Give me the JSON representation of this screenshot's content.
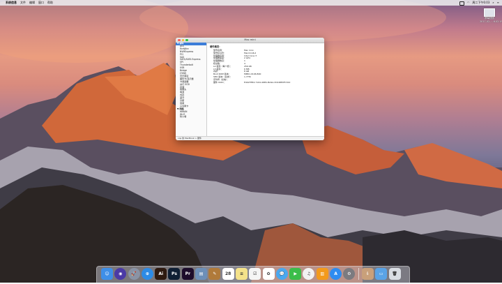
{
  "menubar": {
    "apple": "",
    "items": [
      "系统信息",
      "文件",
      "编辑",
      "窗口",
      "帮助"
    ],
    "clock": "周二下午6:03"
  },
  "desktop": {
    "file_label_1": "屏幕快照",
    "file_label_2": "2017-02-... 6.02.19"
  },
  "window": {
    "title": "Mac mini",
    "sidebar": [
      {
        "label": "▼ 硬件",
        "type": "hdr",
        "selected": true
      },
      {
        "label": "ATA",
        "type": "item"
      },
      {
        "label": "FireWire",
        "type": "item"
      },
      {
        "label": "NVMExpress",
        "type": "item"
      },
      {
        "label": "PCI",
        "type": "item"
      },
      {
        "label": "SAS",
        "type": "item"
      },
      {
        "label": "SATA/SATA Express",
        "type": "item"
      },
      {
        "label": "SPI",
        "type": "item"
      },
      {
        "label": "Thunderbolt",
        "type": "item"
      },
      {
        "label": "USB",
        "type": "item"
      },
      {
        "label": "Bridge",
        "type": "item"
      },
      {
        "label": "打印机",
        "type": "item"
      },
      {
        "label": "光纤通道",
        "type": "item"
      },
      {
        "label": "图形卡/显示器",
        "type": "item"
      },
      {
        "label": "卡阅读器",
        "type": "item"
      },
      {
        "label": "并行 SCSI",
        "type": "item"
      },
      {
        "label": "存储",
        "type": "item"
      },
      {
        "label": "摄像头",
        "type": "item"
      },
      {
        "label": "电源",
        "type": "item"
      },
      {
        "label": "内存",
        "type": "item"
      },
      {
        "label": "蓝牙",
        "type": "item"
      },
      {
        "label": "诊断",
        "type": "item"
      },
      {
        "label": "音频",
        "type": "item"
      },
      {
        "label": "以太网卡",
        "type": "item"
      },
      {
        "label": "▼ 网络",
        "type": "hdr"
      },
      {
        "label": "WWAN",
        "type": "item"
      },
      {
        "label": "Wi-Fi",
        "type": "item"
      },
      {
        "label": "防火墙",
        "type": "item"
      }
    ],
    "detail": {
      "heading": "硬件概览：",
      "rows": [
        {
          "k": "型号名称：",
          "v": "Mac mini"
        },
        {
          "k": "型号标识符：",
          "v": "Macmini6,2"
        },
        {
          "k": "处理器名称：",
          "v": "Intel Core i7"
        },
        {
          "k": "处理器速度：",
          "v": "2 GHz"
        },
        {
          "k": "处理器数目：",
          "v": "1"
        },
        {
          "k": "核总数：",
          "v": "4"
        },
        {
          "k": "L2 缓存（每个核）：",
          "v": "256 KB"
        },
        {
          "k": "L3 缓存：",
          "v": "6 MB"
        },
        {
          "k": "内存：",
          "v": "8 GB"
        },
        {
          "k": "Boot ROM 版本：",
          "v": "MM61.0106.B00"
        },
        {
          "k": "SMC 版本（系统）：",
          "v": "1.77f0"
        },
        {
          "k": "序列号（系统）：",
          "v": ""
        },
        {
          "k": "硬件 UUID：",
          "v": "E4927E84-7104-4DB1-BA9A-3C048E0FC322"
        }
      ]
    },
    "statusbar": "cqs 的 MacBook > 硬件"
  },
  "dock": {
    "calendar_day": "28",
    "apps": [
      {
        "name": "finder",
        "bg": "#3f8fe8",
        "glyph": "☺",
        "round": false
      },
      {
        "name": "siri",
        "bg": "#4b3aa6",
        "glyph": "◉",
        "round": true
      },
      {
        "name": "launchpad",
        "bg": "#8a93a5",
        "glyph": "🚀",
        "round": true
      },
      {
        "name": "safari",
        "bg": "#2d8be6",
        "glyph": "⊕",
        "round": true
      },
      {
        "name": "illustrator",
        "bg": "#2e1a10",
        "glyph": "Ai",
        "round": false
      },
      {
        "name": "photoshop",
        "bg": "#0f1f34",
        "glyph": "Ps",
        "round": false
      },
      {
        "name": "premiere",
        "bg": "#1d0c2b",
        "glyph": "Pr",
        "round": false
      },
      {
        "name": "preview",
        "bg": "#6d8fb8",
        "glyph": "▤",
        "round": false
      },
      {
        "name": "notes-app",
        "bg": "#b07a3a",
        "glyph": "✎",
        "round": false
      },
      {
        "name": "calendar",
        "bg": "#ffffff",
        "glyph": "28",
        "round": false,
        "dark": true
      },
      {
        "name": "notes",
        "bg": "#f4e28a",
        "glyph": "≡",
        "round": false,
        "dark": true
      },
      {
        "name": "reminders",
        "bg": "#f5f5f5",
        "glyph": "☑",
        "round": false,
        "dark": true
      },
      {
        "name": "photos",
        "bg": "#ffffff",
        "glyph": "✿",
        "round": false,
        "dark": true
      },
      {
        "name": "messages",
        "bg": "#4aa8ef",
        "glyph": "💬",
        "round": true
      },
      {
        "name": "facetime",
        "bg": "#3bbd4a",
        "glyph": "▶",
        "round": false
      },
      {
        "name": "itunes",
        "bg": "#f2f2f2",
        "glyph": "♫",
        "round": true,
        "dark": true
      },
      {
        "name": "ibooks",
        "bg": "#f39a1c",
        "glyph": "▥",
        "round": false
      },
      {
        "name": "app-store",
        "bg": "#2f8cf0",
        "glyph": "A",
        "round": true
      },
      {
        "name": "system-preferences",
        "bg": "#7b7b80",
        "glyph": "⚙",
        "round": true
      }
    ],
    "right": [
      {
        "name": "downloads",
        "bg": "#c9a07a",
        "glyph": "⇩",
        "round": false
      },
      {
        "name": "folder",
        "bg": "#5aa3e6",
        "glyph": "▭",
        "round": false
      },
      {
        "name": "trash",
        "bg": "#d9dde3",
        "glyph": "🗑",
        "round": false,
        "dark": true
      }
    ]
  }
}
